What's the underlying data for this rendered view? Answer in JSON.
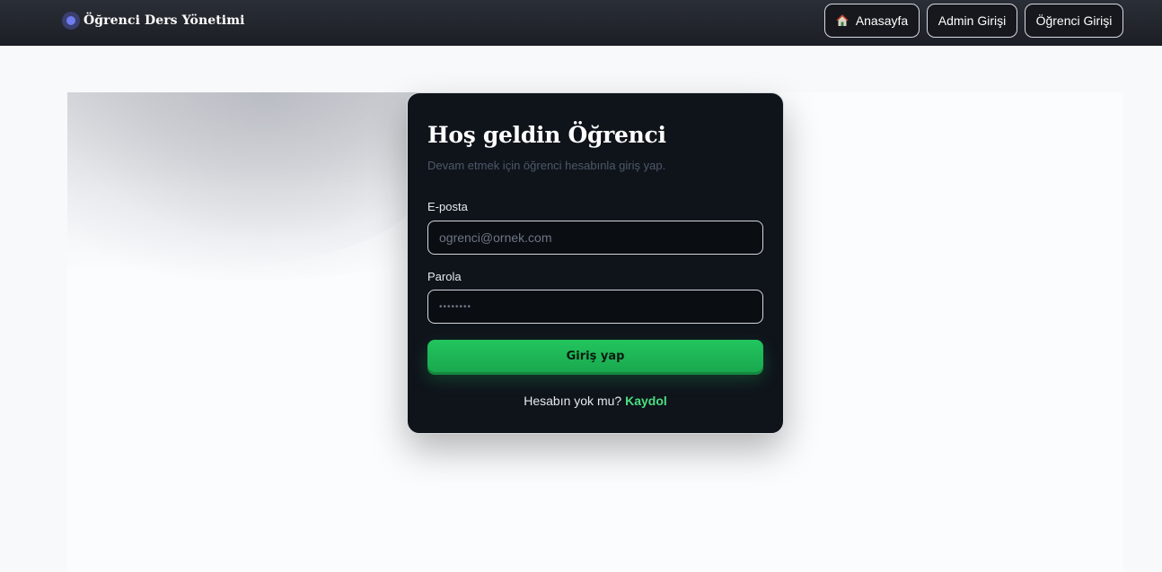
{
  "brand": {
    "name": "Öğrenci Ders Yönetimi",
    "icon": "brand-dot-icon",
    "accent": "#6f7cf0"
  },
  "nav": {
    "home": {
      "label": "Anasayfa",
      "icon": "house-icon"
    },
    "admin": {
      "label": "Admin Girişi"
    },
    "student": {
      "label": "Öğrenci Girişi"
    }
  },
  "login": {
    "title": "Hoş geldin Öğrenci",
    "subtitle": "Devam etmek için öğrenci hesabınla giriş yap.",
    "email": {
      "label": "E-posta",
      "placeholder": "ogrenci@ornek.com",
      "value": ""
    },
    "password": {
      "label": "Parola",
      "placeholder": "••••••••",
      "value": ""
    },
    "submit_label": "Giriş yap",
    "signup_prompt": "Hesabın yok mu?",
    "signup_link": "Kaydol"
  },
  "colors": {
    "primary": "#22c55e",
    "link": "#4ade80",
    "card_bg": "#0f141b",
    "topbar_bg": "#1f2228"
  }
}
